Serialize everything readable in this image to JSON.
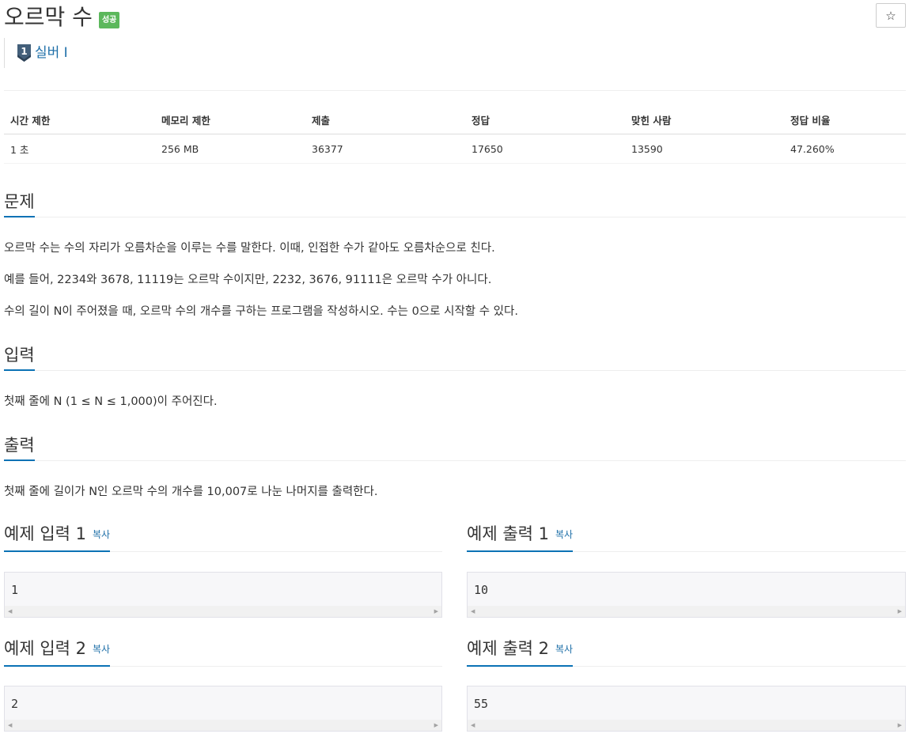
{
  "header": {
    "title": "오르막 수",
    "badge": "성공",
    "star": "☆",
    "tier_number": "1",
    "tier_label": "실버 I"
  },
  "info": {
    "headers": [
      "시간 제한",
      "메모리 제한",
      "제출",
      "정답",
      "맞힌 사람",
      "정답 비율"
    ],
    "values": [
      "1 초",
      "256 MB",
      "36377",
      "17650",
      "13590",
      "47.260%"
    ]
  },
  "problem": {
    "heading": "문제",
    "lines": [
      "오르막 수는 수의 자리가 오름차순을 이루는 수를 말한다. 이때, 인접한 수가 같아도 오름차순으로 친다.",
      "예를 들어, 2234와 3678, 11119는 오르막 수이지만, 2232, 3676, 91111은 오르막 수가 아니다.",
      "수의 길이 N이 주어졌을 때, 오르막 수의 개수를 구하는 프로그램을 작성하시오. 수는 0으로 시작할 수 있다."
    ]
  },
  "input": {
    "heading": "입력",
    "text": "첫째 줄에 N (1 ≤ N ≤ 1,000)이 주어진다."
  },
  "output": {
    "heading": "출력",
    "text": "첫째 줄에 길이가 N인 오르막 수의 개수를 10,007로 나눈 나머지를 출력한다."
  },
  "samples": {
    "copy_label": "복사",
    "items": [
      {
        "in_title": "예제 입력 1",
        "in_value": "1",
        "out_title": "예제 출력 1",
        "out_value": "10"
      },
      {
        "in_title": "예제 입력 2",
        "in_value": "2",
        "out_title": "예제 출력 2",
        "out_value": "55"
      }
    ]
  },
  "colors": {
    "accent": "#0b72b5",
    "link": "#1e6fa8",
    "success": "#5cb85c"
  }
}
